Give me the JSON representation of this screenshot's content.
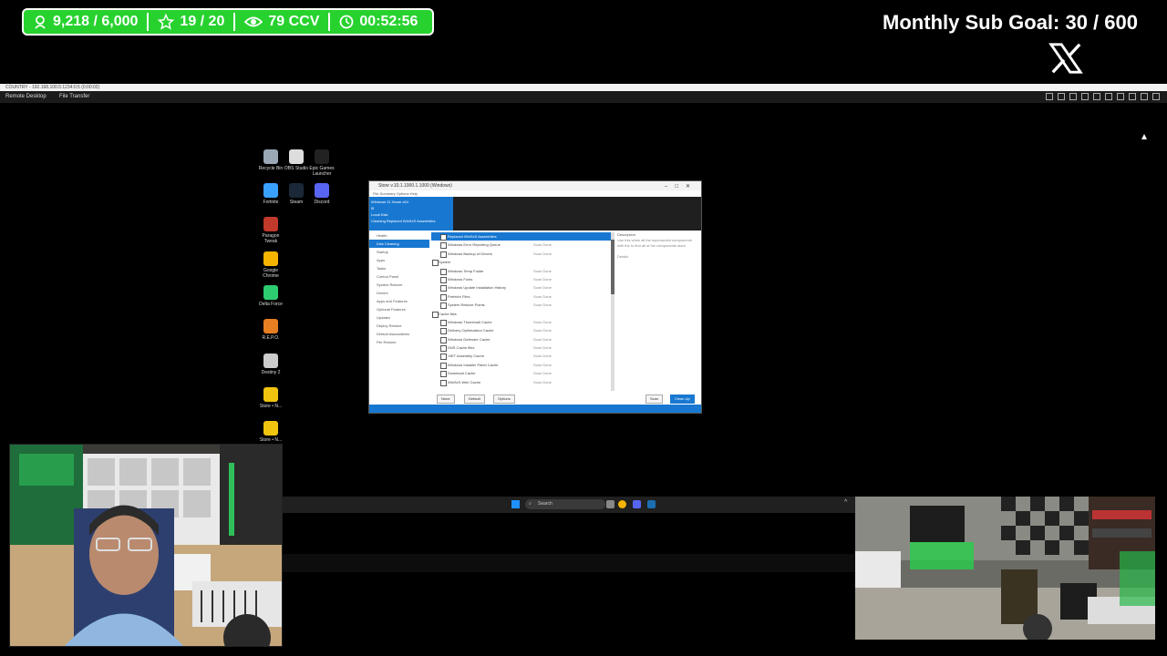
{
  "stream_stats": {
    "followers": "9,218 / 6,000",
    "goal": "19 / 20",
    "viewers": "79 CCV",
    "uptime": "00:52:56"
  },
  "sub_goal": "Monthly Sub Goal:  30 / 600",
  "remote_desktop": {
    "title": "COUNTRY  -  192.168.100.5:1234:0:5  (0:00:02)",
    "tab_remote": "Remote Desktop",
    "tab_file": "File Transfer"
  },
  "desktop_icons": [
    {
      "label": "Recycle Bin",
      "color": "#9aa8b6"
    },
    {
      "label": "OBS Studio",
      "color": "#dddddd"
    },
    {
      "label": "Epic Games Launcher",
      "color": "#222222"
    },
    {
      "label": "Fortnite",
      "color": "#3aa0ff"
    },
    {
      "label": "Steam",
      "color": "#1b2838"
    },
    {
      "label": "Discord",
      "color": "#5865f2"
    },
    {
      "label": "Paragon Tweak",
      "color": "#c0392b"
    },
    {
      "label": "Google Chrome",
      "color": "#f4b400"
    },
    {
      "label": "Delta Force",
      "color": "#2ecc71"
    },
    {
      "label": "R.E.P.O.",
      "color": "#e67e22"
    },
    {
      "label": "Destiny 2",
      "color": "#cccccc"
    },
    {
      "label": "Store • N...",
      "color": "#f1c40f"
    },
    {
      "label": "Store • N...",
      "color": "#f1c40f"
    }
  ],
  "app": {
    "title": "Store v.10.1.1000.1.1000 (Windows)",
    "menu": "File   Summary   Options   Help",
    "banner_lines": [
      "Windows 11 Home x64",
      "i5",
      "Local Disk",
      "Cleaning Replaced WinSxS Assemblies"
    ],
    "nav": [
      "Health",
      "Disk Cleaning",
      "Startup",
      "Apps",
      "Tasks",
      "Control Panel",
      "System Restore",
      "Drivers",
      "Apps and Features",
      "Optional Features",
      "Updates",
      "Deploy Restore",
      "Default Associations",
      "File Restore"
    ],
    "list": [
      {
        "text": "Replaced WinSxS Assemblies",
        "status": "",
        "type": "row",
        "hi": true
      },
      {
        "text": "Windows Error Reporting Queue",
        "status": "Scan Done",
        "type": "row"
      },
      {
        "text": "Windows Backup of Drivers",
        "status": "Scan Done",
        "type": "row"
      },
      {
        "text": "System",
        "status": "",
        "type": "hdr"
      },
      {
        "text": "Windows Temp Folder",
        "status": "Scan Done",
        "type": "row"
      },
      {
        "text": "Windows Fonts",
        "status": "Scan Done",
        "type": "row"
      },
      {
        "text": "Windows Update Installation History",
        "status": "Scan Done",
        "type": "row"
      },
      {
        "text": "Prefetch Files",
        "status": "Scan Done",
        "type": "row"
      },
      {
        "text": "System Restore Points",
        "status": "Scan Done",
        "type": "row"
      },
      {
        "text": "Cache files",
        "status": "",
        "type": "hdr"
      },
      {
        "text": "Windows Thumbnail Cache",
        "status": "Scan Done",
        "type": "row"
      },
      {
        "text": "Delivery Optimization Cache",
        "status": "Scan Done",
        "type": "row"
      },
      {
        "text": "Windows Defender Cache",
        "status": "Scan Done",
        "type": "row"
      },
      {
        "text": "DNS Cache files",
        "status": "Scan Done",
        "type": "row"
      },
      {
        "text": ".NET Assembly Cache",
        "status": "Scan Done",
        "type": "row"
      },
      {
        "text": "Windows Installer Patch Cache",
        "status": "Scan Done",
        "type": "row"
      },
      {
        "text": "Download Cache",
        "status": "Scan Done",
        "type": "row"
      },
      {
        "text": "WinSxS Web Cache",
        "status": "Scan Done",
        "type": "row"
      }
    ],
    "desc_title": "Description",
    "desc_text": "Use this when all the superseded components with the to find all of the components store.",
    "desc_sub": "Details",
    "btn_none": "None",
    "btn_default": "Default",
    "btn_options": "Options",
    "btn_scan": "Scan",
    "btn_clean": "Clean Up"
  },
  "taskbar": {
    "search_placeholder": "Search",
    "caret": "^"
  },
  "colors": {
    "stats_green": "#27d22e",
    "accent_blue": "#1878d1"
  }
}
